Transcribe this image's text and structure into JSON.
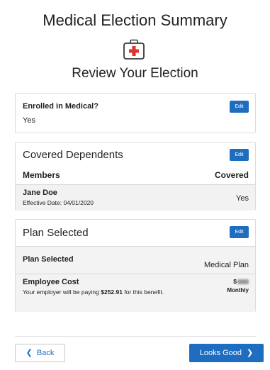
{
  "header": {
    "title": "Medical Election Summary",
    "icon": "first-aid-kit-icon",
    "subtitle": "Review Your Election"
  },
  "enrolled": {
    "question": "Enrolled in Medical?",
    "answer": "Yes",
    "edit_label": "Edit"
  },
  "dependents": {
    "title": "Covered Dependents",
    "edit_label": "Edit",
    "columns": [
      "Members",
      "Covered"
    ],
    "rows": [
      {
        "name": "Jane Doe",
        "effective": "Effective Date: 04/01/2020",
        "covered": "Yes"
      }
    ]
  },
  "plan": {
    "title": "Plan Selected",
    "edit_label": "Edit",
    "plan_label": "Plan Selected",
    "plan_value": "Medical Plan",
    "cost_label": "Employee Cost",
    "cost_note_prefix": "Your employer will be paying ",
    "cost_note_amount": "$252.91",
    "cost_note_suffix": " for this benefit.",
    "cost_amount_prefix": "$",
    "cost_period": "Monthly"
  },
  "footer": {
    "back_label": "Back",
    "next_label": "Looks Good"
  },
  "colors": {
    "primary": "#1f6dc0",
    "kit_red": "#e2322d"
  }
}
